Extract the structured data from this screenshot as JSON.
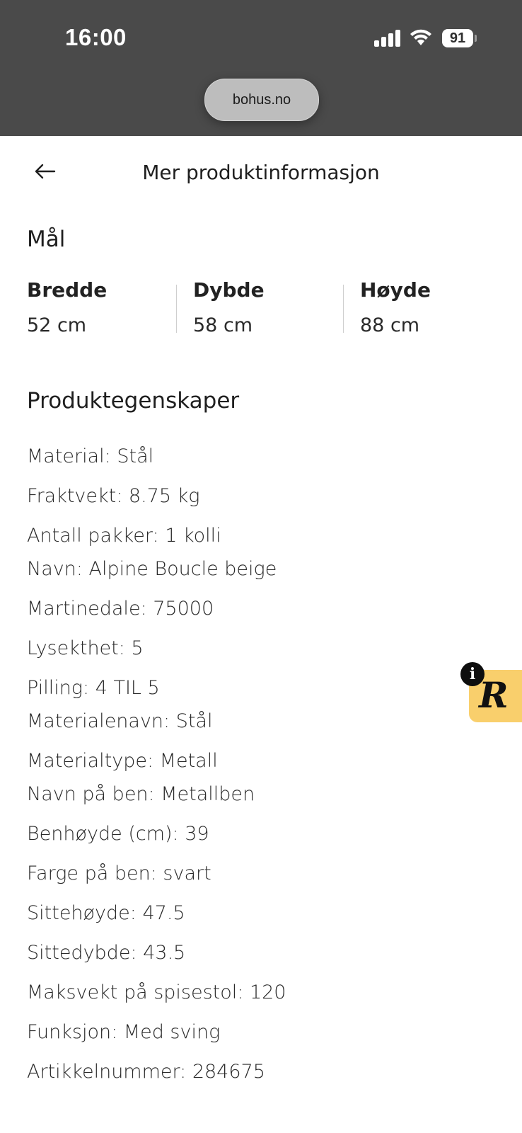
{
  "status_bar": {
    "time": "16:00",
    "battery": "91",
    "icons": [
      "signal-icon",
      "wifi-icon",
      "battery-icon"
    ]
  },
  "browser": {
    "url": "bohus.no"
  },
  "header": {
    "back_icon": "arrow-left-icon",
    "title": "Mer produktinformasjon"
  },
  "dimensions": {
    "heading": "Mål",
    "items": [
      {
        "label": "Bredde",
        "value": "52 cm"
      },
      {
        "label": "Dybde",
        "value": "58 cm"
      },
      {
        "label": "Høyde",
        "value": "88 cm"
      }
    ]
  },
  "properties": {
    "heading": "Produktegenskaper",
    "items": [
      "Material: Stål",
      "Fraktvekt: 8.75 kg",
      "Antall pakker: 1 kolli",
      "Navn: Alpine Boucle beige",
      "Martinedale: 75000",
      "Lysekthet: 5",
      "Pilling: 4 TIL 5",
      "Materialenavn: Stål",
      "Materialtype: Metall",
      "Navn på ben: Metallben",
      "Benhøyde (cm): 39",
      "Farge på ben: svart",
      "Sittehøyde: 47.5",
      "Sittedybde: 43.5",
      "Maksvekt på spisestol: 120",
      "Funksjon: Med sving",
      "Artikkelnummer: 284675"
    ]
  },
  "floating_widget": {
    "letter": "R",
    "info_glyph": "i",
    "background": "#f9cf6c"
  }
}
